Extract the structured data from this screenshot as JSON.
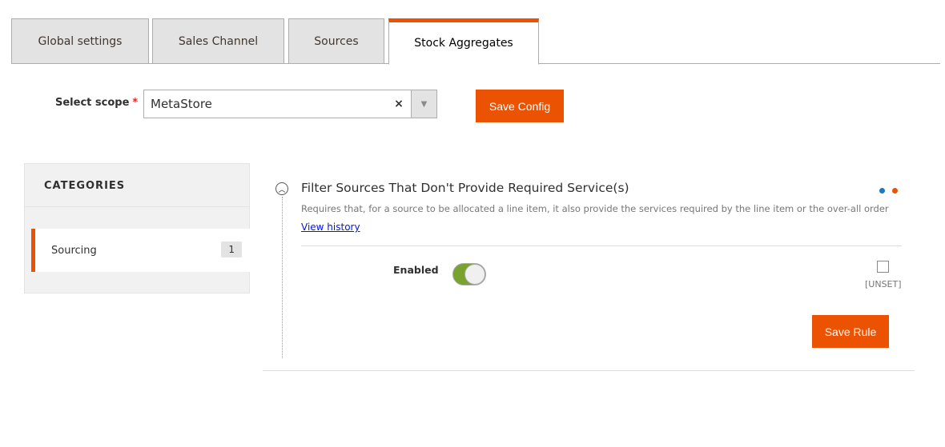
{
  "tabs": [
    {
      "label": "Global settings"
    },
    {
      "label": "Sales Channel"
    },
    {
      "label": "Sources"
    },
    {
      "label": "Stock Aggregates",
      "active": true
    }
  ],
  "scope": {
    "label": "Select scope",
    "required": "*",
    "value": "MetaStore",
    "clear": "×",
    "arrow": "▼"
  },
  "save_config": "Save Config",
  "categories": {
    "title": "CATEGORIES",
    "items": [
      {
        "label": "Sourcing",
        "count": "1"
      }
    ]
  },
  "rule": {
    "collapse_icon": "chevron-up-circle",
    "title": "Filter Sources That Don't Provide Required Service(s)",
    "description": "Requires that, for a source to be allocated a line item, it also provide the services required by the line item or the over-all order",
    "view_history": "View history",
    "indicator_colors": [
      "#1979c3",
      "#eb5202"
    ],
    "enabled_label": "Enabled",
    "enabled": true,
    "unset_label": "[UNSET]",
    "unset_checked": false,
    "save_rule": "Save Rule"
  },
  "colors": {
    "accent": "#eb5202",
    "toggle_on": "#79a22e"
  }
}
